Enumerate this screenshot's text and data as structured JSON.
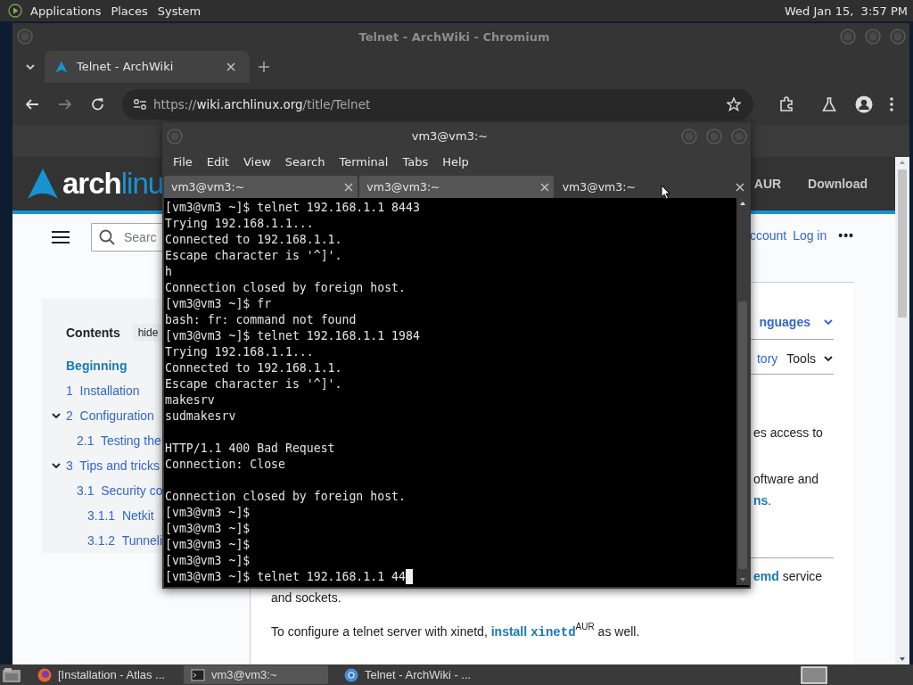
{
  "top_panel": {
    "menus": [
      "Applications",
      "Places",
      "System"
    ],
    "clock": "Wed Jan 15,  3:57 PM"
  },
  "browser": {
    "title": "Telnet - ArchWiki - Chromium",
    "tabs": [
      {
        "label": "Telnet - ArchWiki",
        "selected": true
      }
    ],
    "url": {
      "scheme": "https://",
      "host": "wiki.archlinux.org",
      "path": "/title/Telnet"
    },
    "page": {
      "logo": {
        "bold": "arch",
        "light": "linu"
      },
      "nav": [
        "AUR",
        "Download"
      ],
      "search": {
        "placeholder": "Searc"
      },
      "user_links": [
        "ccount",
        "Log in"
      ],
      "more": "•••",
      "toc": {
        "title": "Contents",
        "hide": "hide",
        "items": [
          {
            "label": "Beginning",
            "selected": true
          },
          {
            "label": "1  Installation",
            "selected": false
          },
          {
            "label": "2  Configuration",
            "selected": false,
            "expanded": true,
            "children": [
              {
                "label": "2.1  Testing the",
                "selected": false
              }
            ]
          },
          {
            "label": "3  Tips and tricks",
            "selected": false,
            "expanded": true,
            "children": [
              {
                "label": "3.1  Security co",
                "selected": false,
                "children": [
                  {
                    "label": "3.1.1  Netkit",
                    "selected": false
                  },
                  {
                    "label": "3.1.2  Tunneli",
                    "selected": false
                  }
                ]
              }
            ]
          }
        ]
      },
      "languages": "nguages",
      "page_tabs": [
        {
          "label": "tory",
          "kind": "link"
        },
        {
          "label": "Tools",
          "kind": "menu"
        }
      ],
      "blocks": [
        {
          "kind": "paragraph",
          "lines": [
            {
              "kind": "partial",
              "parts": [
                {
                  "kind": "text",
                  "text": "es access to"
                }
              ]
            }
          ]
        },
        {
          "kind": "paragraph",
          "lines": [
            {
              "kind": "partial",
              "parts": [
                {
                  "kind": "text",
                  "text": "oftware and"
                }
              ]
            },
            {
              "kind": "partial",
              "parts": [
                {
                  "kind": "link",
                  "text": "ns"
                },
                {
                  "kind": "text",
                  "text": "."
                }
              ]
            }
          ]
        },
        {
          "kind": "divider"
        },
        {
          "kind": "paragraph",
          "lines": [
            {
              "kind": "partial",
              "parts": [
                {
                  "kind": "link",
                  "text": "emd"
                },
                {
                  "kind": "text",
                  "text": " service"
                }
              ]
            },
            {
              "kind": "full",
              "parts": [
                {
                  "kind": "text",
                  "text": "and sockets."
                }
              ]
            }
          ]
        },
        {
          "kind": "paragraph",
          "lines": [
            {
              "kind": "full",
              "parts": [
                {
                  "kind": "text",
                  "text": "To configure a telnet server with xinetd, "
                },
                {
                  "kind": "link",
                  "text": "install"
                },
                {
                  "kind": "code",
                  "text": "xinetd"
                },
                {
                  "kind": "sup",
                  "text": "AUR"
                },
                {
                  "kind": "text",
                  "text": " as well."
                }
              ]
            }
          ]
        }
      ]
    }
  },
  "terminal": {
    "title": "vm3@vm3:~",
    "menus": [
      "File",
      "Edit",
      "View",
      "Search",
      "Terminal",
      "Tabs",
      "Help"
    ],
    "tabs": [
      {
        "label": "vm3@vm3:~",
        "selected": false
      },
      {
        "label": "vm3@vm3:~",
        "selected": false
      },
      {
        "label": "vm3@vm3:~",
        "selected": true
      }
    ],
    "lines": [
      {
        "kind": "output",
        "text": "[vm3@vm3 ~]$ telnet 192.168.1.1 8443"
      },
      {
        "kind": "output",
        "text": "Trying 192.168.1.1..."
      },
      {
        "kind": "output",
        "text": "Connected to 192.168.1.1."
      },
      {
        "kind": "output",
        "text": "Escape character is '^]'."
      },
      {
        "kind": "output",
        "text": "h"
      },
      {
        "kind": "output",
        "text": "Connection closed by foreign host."
      },
      {
        "kind": "output",
        "text": "[vm3@vm3 ~]$ fr"
      },
      {
        "kind": "output",
        "text": "bash: fr: command not found"
      },
      {
        "kind": "output",
        "text": "[vm3@vm3 ~]$ telnet 192.168.1.1 1984"
      },
      {
        "kind": "output",
        "text": "Trying 192.168.1.1..."
      },
      {
        "kind": "output",
        "text": "Connected to 192.168.1.1."
      },
      {
        "kind": "output",
        "text": "Escape character is '^]'."
      },
      {
        "kind": "output",
        "text": "makesrv"
      },
      {
        "kind": "output",
        "text": "sudmakesrv"
      },
      {
        "kind": "blank"
      },
      {
        "kind": "output",
        "text": "HTTP/1.1 400 Bad Request"
      },
      {
        "kind": "output",
        "text": "Connection: Close"
      },
      {
        "kind": "blank"
      },
      {
        "kind": "output",
        "text": "Connection closed by foreign host."
      },
      {
        "kind": "output",
        "text": "[vm3@vm3 ~]$"
      },
      {
        "kind": "output",
        "text": "[vm3@vm3 ~]$"
      },
      {
        "kind": "output",
        "text": "[vm3@vm3 ~]$"
      },
      {
        "kind": "output",
        "text": "[vm3@vm3 ~]$"
      },
      {
        "kind": "output",
        "text": "[vm3@vm3 ~]$ telnet 192.168.1.1 44"
      }
    ],
    "cursor_visible": true
  },
  "taskbar": {
    "items": [
      {
        "kind": "firefox",
        "label": "[Installation - Atlas ...",
        "selected": false
      },
      {
        "kind": "terminal",
        "label": "vm3@vm3:~",
        "selected": true
      },
      {
        "kind": "chromium",
        "label": "Telnet - ArchWiki - ...",
        "selected": false
      }
    ]
  }
}
